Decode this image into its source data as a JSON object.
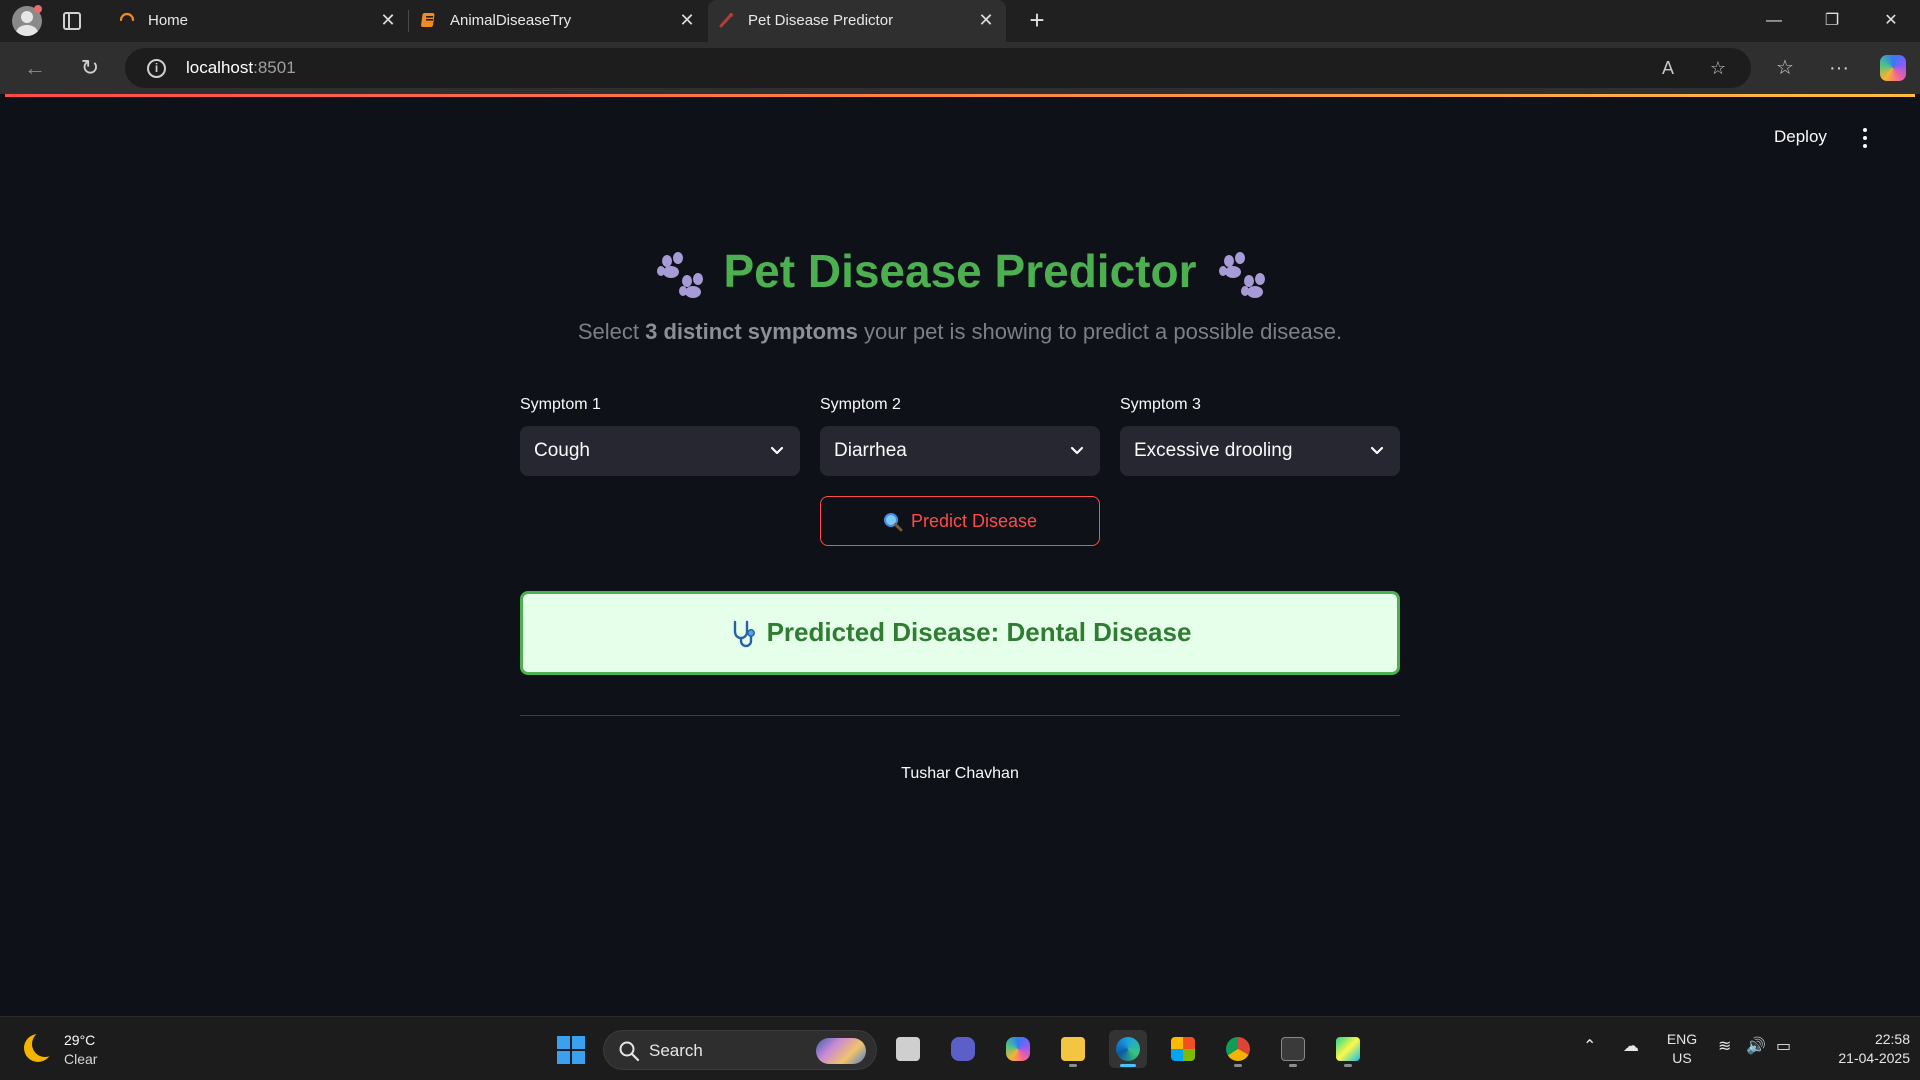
{
  "browser": {
    "tabs": [
      {
        "title": "Home",
        "active": false
      },
      {
        "title": "AnimalDiseaseTry",
        "active": false
      },
      {
        "title": "Pet Disease Predictor",
        "active": true
      }
    ],
    "url_host": "localhost",
    "url_port": ":8501"
  },
  "app": {
    "deploy_label": "Deploy",
    "title": "Pet Disease Predictor",
    "title_emoji": "paw-prints",
    "subtitle_pre": "Select ",
    "subtitle_bold": "3 distinct symptoms",
    "subtitle_post": " your pet is showing to predict a possible disease.",
    "symptoms": [
      {
        "label": "Symptom 1",
        "value": "Cough"
      },
      {
        "label": "Symptom 2",
        "value": "Diarrhea"
      },
      {
        "label": "Symptom 3",
        "value": "Excessive drooling"
      }
    ],
    "predict_button": "Predict Disease",
    "result_text": "Predicted Disease: Dental Disease",
    "footer": "Tushar Chavhan",
    "colors": {
      "title_green": "#4caf50",
      "accent_red": "#ff4b4b",
      "result_bg": "#e6ffea",
      "result_text": "#2e7d32",
      "page_bg": "#0e1117"
    }
  },
  "taskbar": {
    "weather_temp": "29°C",
    "weather_condition": "Clear",
    "search_label": "Search",
    "lang_primary": "ENG",
    "lang_secondary": "US",
    "time": "22:58",
    "date": "21-04-2025"
  }
}
